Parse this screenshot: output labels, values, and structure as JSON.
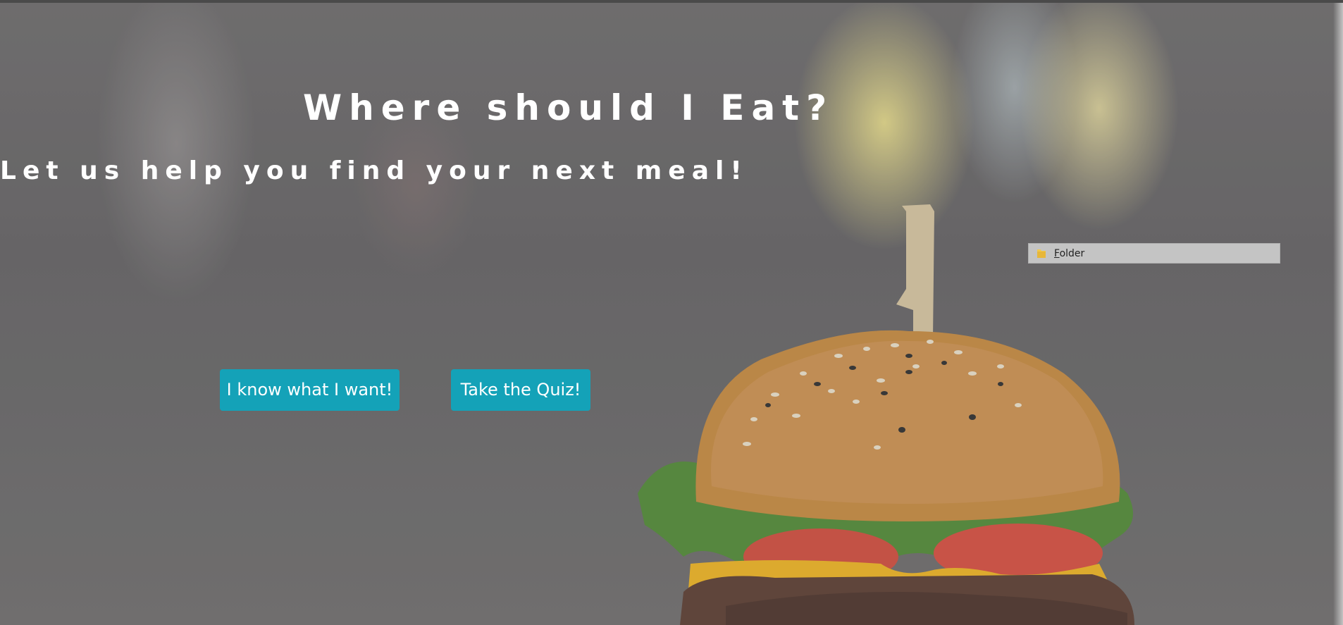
{
  "hero": {
    "title": "Where should I Eat?",
    "subtitle": "Let us help you find your next meal!",
    "background_image": "burger-photo"
  },
  "actions": {
    "know_label": "I know what I want!",
    "quiz_label": "Take the Quiz!"
  },
  "context_item": {
    "label_first": "F",
    "label_rest": "older",
    "icon": "folder-icon"
  },
  "colors": {
    "button": "#14a2b8",
    "text": "#ffffff"
  }
}
